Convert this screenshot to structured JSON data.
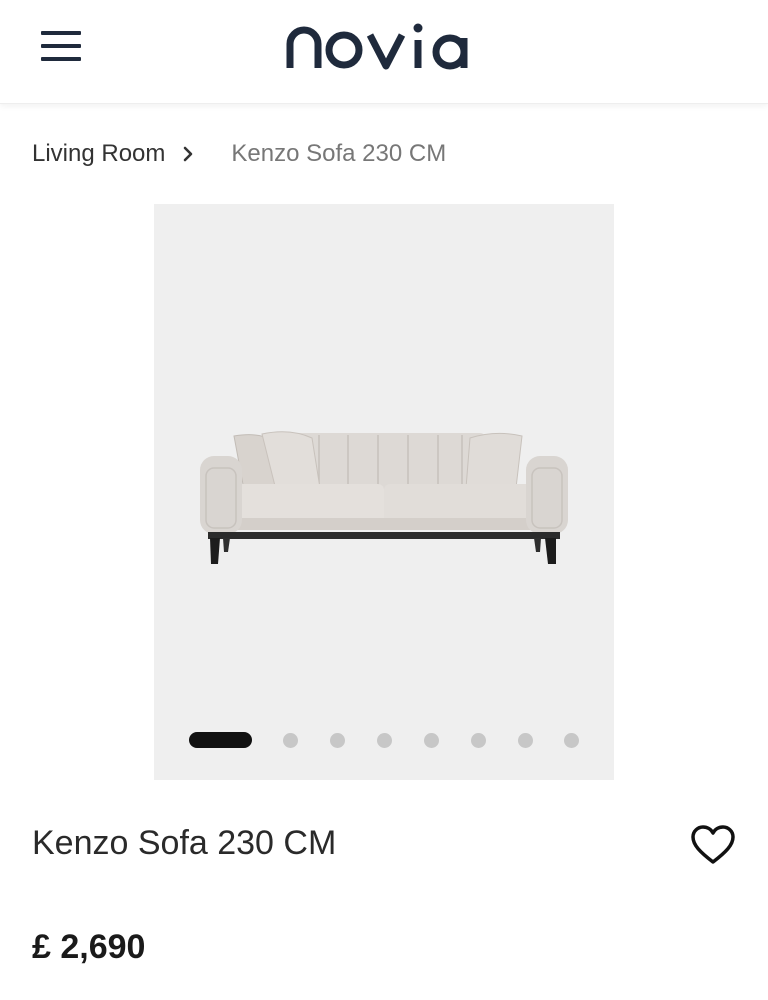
{
  "header": {
    "brand": "novia"
  },
  "breadcrumb": {
    "parent": "Living Room",
    "current": "Kenzo Sofa 230 CM"
  },
  "gallery": {
    "image_alt": "Kenzo Sofa 230 CM",
    "slide_count": 8,
    "active_slide": 1
  },
  "product": {
    "title": "Kenzo Sofa 230 CM",
    "price": "£ 2,690"
  },
  "icons": {
    "menu": "hamburger-menu-icon",
    "breadcrumb_separator": "chevron-right-icon",
    "wishlist": "heart-outline-icon"
  },
  "colors": {
    "brand_navy": "#1f2a3c",
    "gallery_bg": "#efefef",
    "dot_active": "#111111",
    "dot_inactive": "#c7c7c7"
  }
}
